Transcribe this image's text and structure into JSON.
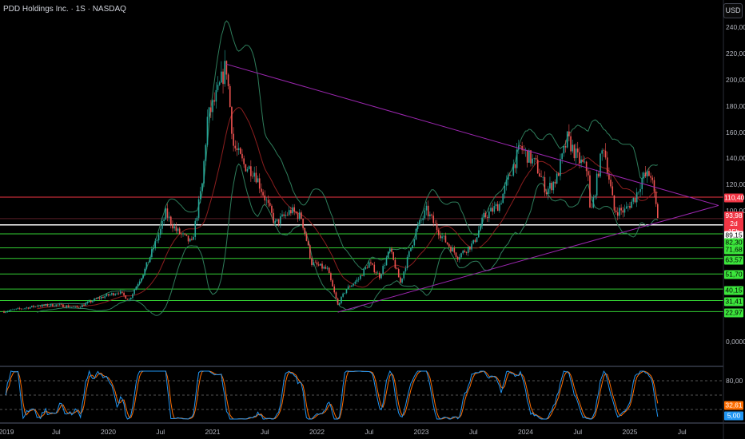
{
  "header": {
    "title": "PDD Holdings Inc. · 1S · NASDAQ",
    "currency_button": "USD"
  },
  "colors": {
    "up": "#26a69a",
    "down": "#ef5350",
    "bb": "#2e7d5b",
    "ma": "#8b1e1e",
    "trend": "#9c27b0",
    "support": "#32cd32",
    "resistance": "#f23645",
    "stoch_k": "#2196f3",
    "stoch_d": "#ff6d00"
  },
  "chart_data": {
    "type": "candlestick",
    "title": "PDD Holdings Inc. · 1S · NASDAQ",
    "ylim": [
      0,
      240
    ],
    "y_ticks": [
      "240,00",
      "220,00",
      "200,00",
      "180,00",
      "160,00",
      "140,00",
      "120,00",
      "100,00",
      "0,0000"
    ],
    "y_tick_values": [
      240,
      220,
      200,
      180,
      160,
      140,
      120,
      100,
      0
    ],
    "x_ticks": [
      {
        "label": "2019",
        "t": 2019.0
      },
      {
        "label": "Jul",
        "t": 2019.5
      },
      {
        "label": "2020",
        "t": 2020.0
      },
      {
        "label": "Jul",
        "t": 2020.5
      },
      {
        "label": "2021",
        "t": 2021.0
      },
      {
        "label": "Jul",
        "t": 2021.5
      },
      {
        "label": "2022",
        "t": 2022.0
      },
      {
        "label": "Jul",
        "t": 2022.5
      },
      {
        "label": "2023",
        "t": 2023.0
      },
      {
        "label": "Jul",
        "t": 2023.5
      },
      {
        "label": "2024",
        "t": 2024.0
      },
      {
        "label": "Jul",
        "t": 2024.5
      },
      {
        "label": "2025",
        "t": 2025.0
      },
      {
        "label": "Jul",
        "t": 2025.5
      }
    ],
    "price_path": [
      [
        2019.0,
        23
      ],
      [
        2019.3,
        27
      ],
      [
        2019.5,
        28
      ],
      [
        2019.7,
        26
      ],
      [
        2019.9,
        33
      ],
      [
        2020.1,
        38
      ],
      [
        2020.2,
        32
      ],
      [
        2020.35,
        55
      ],
      [
        2020.5,
        85
      ],
      [
        2020.55,
        98
      ],
      [
        2020.65,
        85
      ],
      [
        2020.8,
        75
      ],
      [
        2020.9,
        120
      ],
      [
        2020.95,
        170
      ],
      [
        2021.05,
        190
      ],
      [
        2021.13,
        212
      ],
      [
        2021.2,
        150
      ],
      [
        2021.3,
        135
      ],
      [
        2021.4,
        130
      ],
      [
        2021.5,
        110
      ],
      [
        2021.6,
        90
      ],
      [
        2021.75,
        100
      ],
      [
        2021.85,
        95
      ],
      [
        2021.95,
        60
      ],
      [
        2022.1,
        55
      ],
      [
        2022.2,
        28
      ],
      [
        2022.28,
        40
      ],
      [
        2022.4,
        48
      ],
      [
        2022.5,
        60
      ],
      [
        2022.6,
        50
      ],
      [
        2022.7,
        70
      ],
      [
        2022.8,
        45
      ],
      [
        2022.95,
        85
      ],
      [
        2023.05,
        100
      ],
      [
        2023.2,
        80
      ],
      [
        2023.35,
        65
      ],
      [
        2023.5,
        75
      ],
      [
        2023.6,
        95
      ],
      [
        2023.75,
        105
      ],
      [
        2023.85,
        128
      ],
      [
        2023.95,
        148
      ],
      [
        2024.1,
        135
      ],
      [
        2024.2,
        115
      ],
      [
        2024.3,
        125
      ],
      [
        2024.4,
        155
      ],
      [
        2024.5,
        140
      ],
      [
        2024.6,
        130
      ],
      [
        2024.62,
        95
      ],
      [
        2024.72,
        140
      ],
      [
        2024.75,
        150
      ],
      [
        2024.85,
        100
      ],
      [
        2024.95,
        100
      ],
      [
        2025.05,
        110
      ],
      [
        2025.12,
        125
      ],
      [
        2025.2,
        128
      ],
      [
        2025.27,
        94
      ]
    ],
    "horizontal_levels": [
      {
        "value": 110.4,
        "label": "110,40",
        "kind": "resistance"
      },
      {
        "value": 93.98,
        "label": "93,98",
        "sublabel": "2d 15h",
        "kind": "last"
      },
      {
        "value": 89.15,
        "label": "89,15",
        "kind": "white"
      },
      {
        "value": 82.3,
        "label": "82,30",
        "kind": "support"
      },
      {
        "value": 71.68,
        "label": "71,68",
        "kind": "support"
      },
      {
        "value": 63.57,
        "label": "63,57",
        "kind": "support"
      },
      {
        "value": 51.7,
        "label": "51,70",
        "kind": "support"
      },
      {
        "value": 40.15,
        "label": "40,15",
        "kind": "support"
      },
      {
        "value": 31.41,
        "label": "31,41",
        "kind": "support"
      },
      {
        "value": 22.97,
        "label": "22,97",
        "kind": "support"
      }
    ],
    "trendlines": [
      {
        "from": [
          2021.13,
          212
        ],
        "to": [
          2025.85,
          104
        ]
      },
      {
        "from": [
          2022.2,
          22.5
        ],
        "to": [
          2025.85,
          104
        ]
      }
    ],
    "indicators": [
      "Bollinger Bands (20,2)",
      "SMA 20"
    ],
    "oscillator": {
      "name": "Stoch RSI",
      "ticks": [
        "80,00"
      ],
      "levels": [
        80,
        50,
        20
      ],
      "k_value": 5.0,
      "d_value": 32.61,
      "k_label": "5,00",
      "d_label": "32,61"
    }
  }
}
